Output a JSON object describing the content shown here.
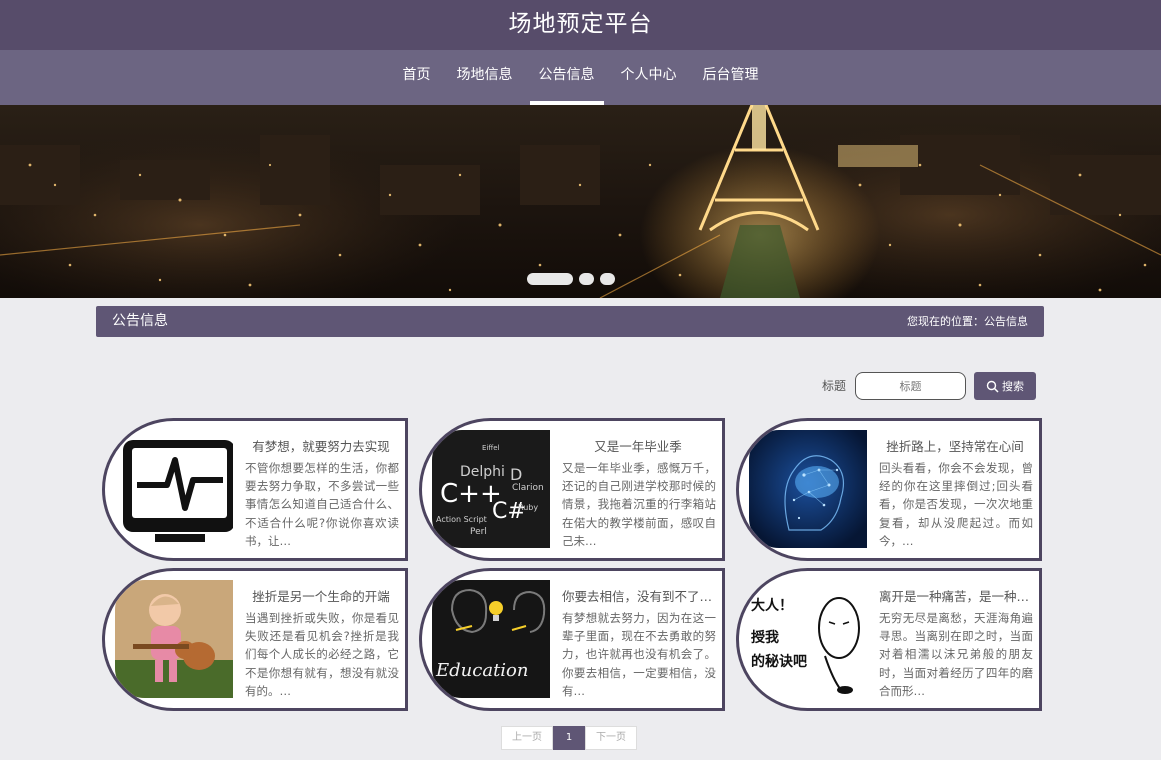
{
  "header": {
    "title": "场地预定平台"
  },
  "nav": {
    "items": [
      "首页",
      "场地信息",
      "公告信息",
      "个人中心",
      "后台管理"
    ],
    "active_index": 2
  },
  "section": {
    "title": "公告信息",
    "location": "您现在的位置：公告信息"
  },
  "search": {
    "label": "标题",
    "placeholder": "标题",
    "button": "搜索"
  },
  "cards": [
    {
      "title": "有梦想，就要努力去实现",
      "desc": "不管你想要怎样的生活，你都要去努力争取，不多尝试一些事情怎么知道自己适合什么、不适合什么呢?你说你喜欢读书，让…",
      "thumb": "monitor-pulse-icon"
    },
    {
      "title": "又是一年毕业季",
      "desc": "又是一年毕业季，感慨万千，还记的自己刚进学校那时候的情景，我拖着沉重的行李箱站在偌大的教学楼前面，感叹自己未…",
      "thumb": "programming-languages"
    },
    {
      "title": "挫折路上，坚持常在心间",
      "desc": " 回头看看，你会不会发现，曾经的你在这里摔倒过;回头看看，你是否发现，一次次地重复看，却从没爬起过。而如今，…",
      "thumb": "brain-network"
    },
    {
      "title": "挫折是另一个生命的开端",
      "desc": "当遇到挫折或失败，你是看见失败还是看见机会?挫折是我们每个人成长的必经之路，它不是你想有就有，想没有就没有的。…",
      "thumb": "baby-guitar"
    },
    {
      "title": "你要去相信，没有到不了的明天",
      "desc": "有梦想就去努力，因为在这一辈子里面，现在不去勇敢的努力，也许就再也没有机会了。你要去相信，一定要相信，没有…",
      "thumb": "education-lightbulb",
      "thumb_text": "Education"
    },
    {
      "title": "离开是一种痛苦，是一种成长",
      "desc": "无穷无尽是离愁，天涯海角遍寻思。当离别在即之时，当面对着相濡以沫兄弟般的朋友时，当面对着经历了四年的磨合而形…",
      "thumb": "cartoon-comic",
      "thumb_text": [
        "大人！",
        "授我",
        "的秘诀吧"
      ]
    }
  ],
  "pagination": {
    "prev": "上一页",
    "current": "1",
    "next": "下一页"
  }
}
